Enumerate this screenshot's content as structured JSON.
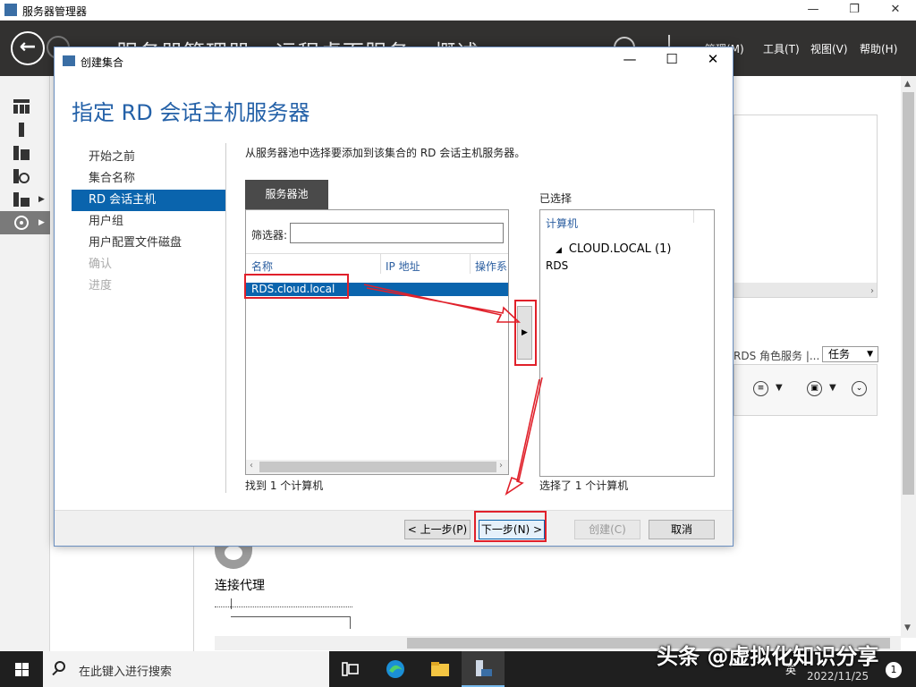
{
  "app": {
    "title": "服务器管理器",
    "breadcrumb": "服务器管理器 › 远程桌面服务 › 概述",
    "menu": [
      "管理(M)",
      "工具(T)",
      "视图(V)",
      "帮助(H)"
    ],
    "window_controls": [
      "—",
      "❐",
      "✕"
    ]
  },
  "background": {
    "rds_roles_label": "RDS 角色服务  |...",
    "tasks_label": "任务",
    "broker_label": "连接代理"
  },
  "dialog": {
    "title": "创建集合",
    "heading": "指定 RD 会话主机服务器",
    "controls": [
      "—",
      "☐",
      "✕"
    ],
    "steps": [
      {
        "label": "开始之前",
        "state": "done"
      },
      {
        "label": "集合名称",
        "state": "done"
      },
      {
        "label": "RD 会话主机",
        "state": "active"
      },
      {
        "label": "用户组",
        "state": "normal"
      },
      {
        "label": "用户配置文件磁盘",
        "state": "normal"
      },
      {
        "label": "确认",
        "state": "disabled"
      },
      {
        "label": "进度",
        "state": "disabled"
      }
    ],
    "instruction": "从服务器池中选择要添加到该集合的 RD 会话主机服务器。",
    "pool": {
      "tab_label": "服务器池",
      "filter_label": "筛选器:",
      "filter_value": "",
      "columns": [
        "名称",
        "IP 地址",
        "操作系"
      ],
      "rows": [
        "RDS.cloud.local"
      ],
      "found_text": "找到 1 个计算机"
    },
    "add_button": "▶",
    "selected": {
      "label": "已选择",
      "column": "计算机",
      "group": "CLOUD.LOCAL (1)",
      "items": [
        "RDS"
      ],
      "count_text": "选择了 1 个计算机"
    },
    "buttons": {
      "previous": "< 上一步(P)",
      "next": "下一步(N) >",
      "create": "创建(C)",
      "cancel": "取消"
    }
  },
  "taskbar": {
    "search_placeholder": "在此键入进行搜索",
    "ime": "英",
    "date": "2022/11/25",
    "notifications": "1"
  },
  "watermark": "头条 @虚拟化知识分享"
}
